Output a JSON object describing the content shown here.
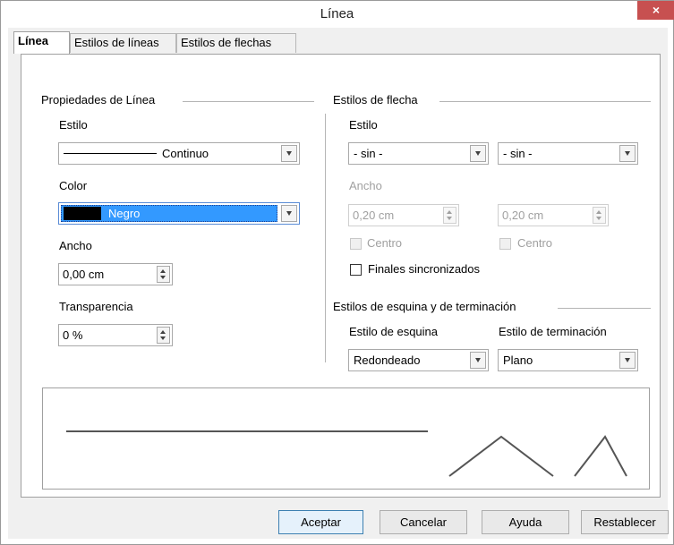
{
  "window": {
    "title": "Línea",
    "close_glyph": "×"
  },
  "tabs": [
    {
      "label": "Línea",
      "active": true
    },
    {
      "label": "Estilos de líneas",
      "active": false
    },
    {
      "label": "Estilos de flechas",
      "active": false
    }
  ],
  "line_properties": {
    "group_title": "Propiedades de Línea",
    "style_label": "Estilo",
    "style_value": "Continuo",
    "color_label": "Color",
    "color_value": "Negro",
    "color_swatch": "#000000",
    "width_label": "Ancho",
    "width_value": "0,00 cm",
    "transparency_label": "Transparencia",
    "transparency_value": "0 %"
  },
  "arrow_styles": {
    "group_title": "Estilos de flecha",
    "style_label": "Estilo",
    "start_style_value": "- sin -",
    "end_style_value": "- sin -",
    "width_label": "Ancho",
    "start_width_value": "0,20 cm",
    "end_width_value": "0,20 cm",
    "center_label": "Centro",
    "synchronize_label": "Finales sincronizados"
  },
  "corner_styles": {
    "group_title": "Estilos de esquina y de terminación",
    "corner_label": "Estilo de esquina",
    "corner_value": "Redondeado",
    "cap_label": "Estilo de terminación",
    "cap_value": "Plano"
  },
  "buttons": {
    "ok": "Aceptar",
    "cancel": "Cancelar",
    "help": "Ayuda",
    "reset": "Restablecer"
  },
  "colors": {
    "close_button": "#c75050",
    "selection": "#3399ff",
    "default_button": "#e5f1fb"
  }
}
